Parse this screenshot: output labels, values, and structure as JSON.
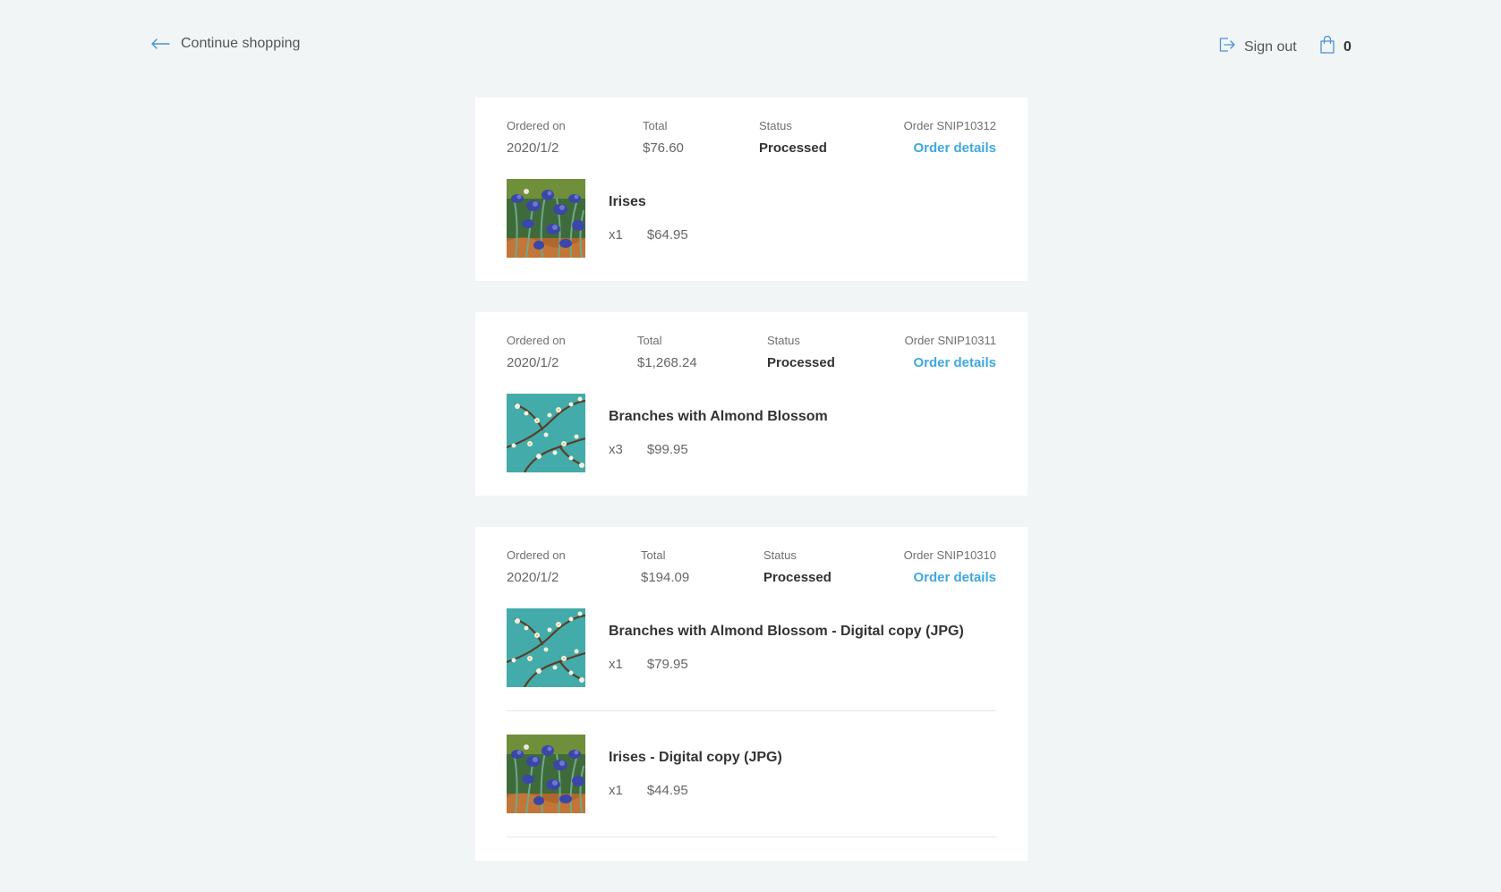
{
  "header": {
    "continue_label": "Continue shopping",
    "signout_label": "Sign out",
    "cart_count": "0"
  },
  "orders": [
    {
      "ordered_on_label": "Ordered on",
      "ordered_on": "2020/1/2",
      "total_label": "Total",
      "total": "$76.60",
      "status_label": "Status",
      "status": "Processed",
      "order_number": "Order SNIP10312",
      "details_label": "Order details",
      "items": [
        {
          "title": "Irises",
          "qty": "x1",
          "price": "$64.95",
          "image": "irises"
        }
      ]
    },
    {
      "ordered_on_label": "Ordered on",
      "ordered_on": "2020/1/2",
      "total_label": "Total",
      "total": "$1,268.24",
      "status_label": "Status",
      "status": "Processed",
      "order_number": "Order SNIP10311",
      "details_label": "Order details",
      "items": [
        {
          "title": "Branches with Almond Blossom",
          "qty": "x3",
          "price": "$99.95",
          "image": "almond"
        }
      ]
    },
    {
      "ordered_on_label": "Ordered on",
      "ordered_on": "2020/1/2",
      "total_label": "Total",
      "total": "$194.09",
      "status_label": "Status",
      "status": "Processed",
      "order_number": "Order SNIP10310",
      "details_label": "Order details",
      "items": [
        {
          "title": "Branches with Almond Blossom - Digital copy (JPG)",
          "qty": "x1",
          "price": "$79.95",
          "image": "almond"
        },
        {
          "title": "Irises - Digital copy (JPG)",
          "qty": "x1",
          "price": "$44.95",
          "image": "irises"
        }
      ]
    }
  ],
  "colors": {
    "background": "#f1f5f6",
    "card": "#ffffff",
    "accent_link": "#3fa9df",
    "icon_blue": "#4a90d9"
  },
  "icons": {
    "back": "arrow-left-icon",
    "signout": "sign-out-icon",
    "cart": "shopping-bag-icon"
  }
}
